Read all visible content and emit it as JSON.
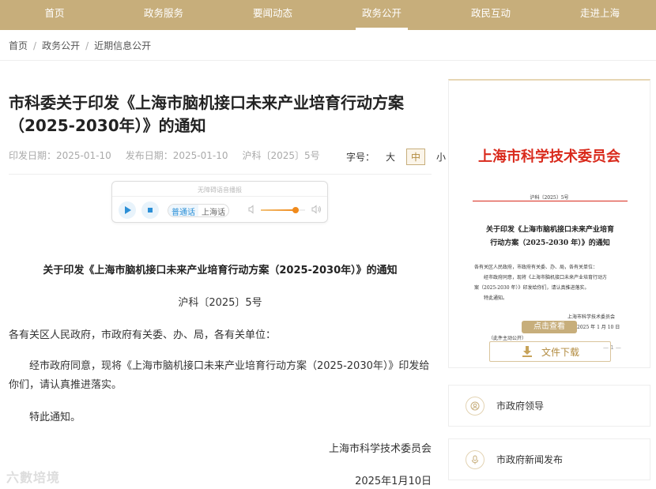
{
  "nav": {
    "items": [
      {
        "label": "首页"
      },
      {
        "label": "政务服务"
      },
      {
        "label": "要闻动态"
      },
      {
        "label": "政务公开"
      },
      {
        "label": "政民互动"
      },
      {
        "label": "走进上海"
      }
    ],
    "active_index": 3
  },
  "breadcrumb": [
    "首页",
    "政务公开",
    "近期信息公开"
  ],
  "article": {
    "title": "市科委关于印发《上海市脑机接口未来产业培育行动方案（2025-2030年）》的通知",
    "issue_date": "印发日期：2025-01-10",
    "publish_date": "发布日期：2025-01-10",
    "doc_number": "沪科〔2025〕5号",
    "font_size_label": "字号：",
    "font_sizes": [
      "大",
      "中",
      "小"
    ],
    "font_size_selected": "中"
  },
  "player": {
    "title": "无障碍语音播报",
    "languages": [
      "普通话",
      "上海话"
    ],
    "selected_language": "普通话",
    "volume_fraction": 0.78,
    "icons": {
      "play": "play-icon",
      "stop": "stop-icon",
      "volume_low": "volume-low-icon",
      "volume_high": "volume-high-icon"
    }
  },
  "body": {
    "doc_title": "关于印发《上海市脑机接口未来产业培育行动方案（2025-2030年）》的通知",
    "doc_no": "沪科〔2025〕5号",
    "salutation": "各有关区人民政府，市政府有关委、办、局，各有关单位：",
    "paragraph": "经市政府同意，现将《上海市脑机接口未来产业培育行动方案（2025-2030年）》印发给你们，请认真推进落实。",
    "closing": "特此通知。",
    "signature": "上海市科学技术委员会",
    "date": "2025年1月10日"
  },
  "watermark": "六數培境",
  "preview": {
    "head": "上海市科学技术委员会",
    "doc_no": "沪科〔2025〕5号",
    "title_line1": "关于印发《上海市脑机接口未来产业培育",
    "title_line2": "行动方案（2025-2030 年）》的通知",
    "body_line1": "各有关区人民政府，市政府有关委、办、局，各有关单位：",
    "body_line2": "经市政府同意，现将《上海市脑机接口未来产业培育行动方",
    "body_line3": "案（2025-2030 年）》印发给你们，请认真推进落实。",
    "body_line4": "特此通知。",
    "sign": "上海市科学技术委员会",
    "date": "2025 年 1 月 10 日",
    "publish_note": "（此件主动公开）",
    "view_button": "点击查看",
    "download_button": "文件下载",
    "page_indicator": "— 1 —",
    "accent": "#d92a1c"
  },
  "side_links": [
    {
      "label": "市政府领导",
      "icon": "leader-icon"
    },
    {
      "label": "市政府新闻发布",
      "icon": "microphone-icon"
    }
  ],
  "colors": {
    "brand": "#c7ae7b",
    "accent_blue": "#2b8fd6",
    "volume": "#f08a1c"
  }
}
